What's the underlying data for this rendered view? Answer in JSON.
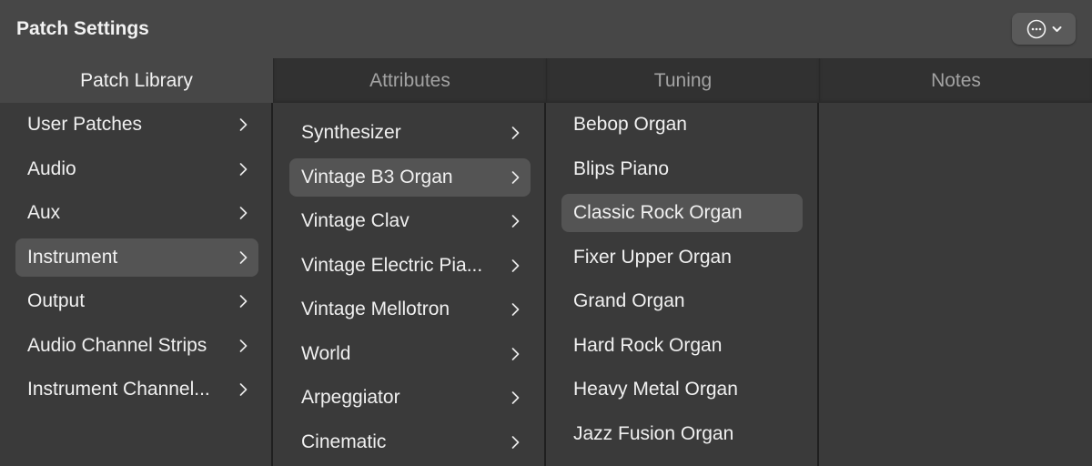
{
  "window": {
    "title": "Patch Settings",
    "menu_button": {
      "icon": "ellipsis-circle-icon",
      "chevron": "chevron-down-icon"
    }
  },
  "tabs": [
    {
      "label": "Patch Library",
      "active": true
    },
    {
      "label": "Attributes",
      "active": false
    },
    {
      "label": "Tuning",
      "active": false
    },
    {
      "label": "Notes",
      "active": false
    }
  ],
  "patch_library": {
    "items": [
      {
        "label": "User Patches",
        "has_submenu": true,
        "selected": false
      },
      {
        "label": "Audio",
        "has_submenu": true,
        "selected": false
      },
      {
        "label": "Aux",
        "has_submenu": true,
        "selected": false
      },
      {
        "label": "Instrument",
        "has_submenu": true,
        "selected": true
      },
      {
        "label": "Output",
        "has_submenu": true,
        "selected": false
      },
      {
        "label": "Audio Channel Strips",
        "has_submenu": true,
        "selected": false
      },
      {
        "label": "Instrument Channel...",
        "has_submenu": true,
        "selected": false
      }
    ]
  },
  "categories": {
    "items": [
      {
        "label": "Synthesizer",
        "has_submenu": true,
        "selected": false
      },
      {
        "label": "Vintage B3 Organ",
        "has_submenu": true,
        "selected": true
      },
      {
        "label": "Vintage Clav",
        "has_submenu": true,
        "selected": false
      },
      {
        "label": "Vintage Electric Pia...",
        "has_submenu": true,
        "selected": false
      },
      {
        "label": "Vintage Mellotron",
        "has_submenu": true,
        "selected": false
      },
      {
        "label": "World",
        "has_submenu": true,
        "selected": false
      },
      {
        "label": "Arpeggiator",
        "has_submenu": true,
        "selected": false
      },
      {
        "label": "Cinematic",
        "has_submenu": true,
        "selected": false
      }
    ]
  },
  "patches": {
    "items": [
      {
        "label": "Bebop Organ",
        "selected": false
      },
      {
        "label": "Blips Piano",
        "selected": false
      },
      {
        "label": "Classic Rock Organ",
        "selected": true
      },
      {
        "label": "Fixer Upper Organ",
        "selected": false
      },
      {
        "label": "Grand Organ",
        "selected": false
      },
      {
        "label": "Hard Rock Organ",
        "selected": false
      },
      {
        "label": "Heavy Metal Organ",
        "selected": false
      },
      {
        "label": "Jazz Fusion Organ",
        "selected": false
      }
    ]
  }
}
